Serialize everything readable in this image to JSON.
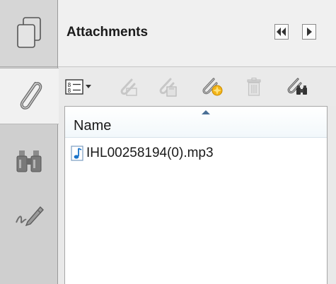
{
  "panel": {
    "title": "Attachments"
  },
  "rail": {
    "items": [
      {
        "name": "pages",
        "icon": "pages-icon"
      },
      {
        "name": "attachments",
        "icon": "paperclip-icon",
        "selected": true
      },
      {
        "name": "search",
        "icon": "binoculars-icon"
      },
      {
        "name": "signatures",
        "icon": "signature-pen-icon"
      }
    ]
  },
  "toolbar": {
    "items": [
      {
        "name": "options",
        "icon": "list-options-icon",
        "enabled": true
      },
      {
        "name": "open",
        "icon": "open-attachment-icon",
        "enabled": false
      },
      {
        "name": "save",
        "icon": "save-attachment-icon",
        "enabled": false
      },
      {
        "name": "add",
        "icon": "add-attachment-icon",
        "enabled": true
      },
      {
        "name": "delete",
        "icon": "trash-icon",
        "enabled": false
      },
      {
        "name": "search",
        "icon": "search-attachments-icon",
        "enabled": true
      }
    ]
  },
  "list": {
    "columns": [
      "Name"
    ],
    "rows": [
      {
        "name": "IHL00258194(0).mp3",
        "icon": "audio-file-icon"
      }
    ]
  },
  "colors": {
    "rail": "#cfcfcf",
    "panel": "#e9e9e9",
    "audio_icon": "#1a73c9",
    "add_star": "#f2b418"
  }
}
